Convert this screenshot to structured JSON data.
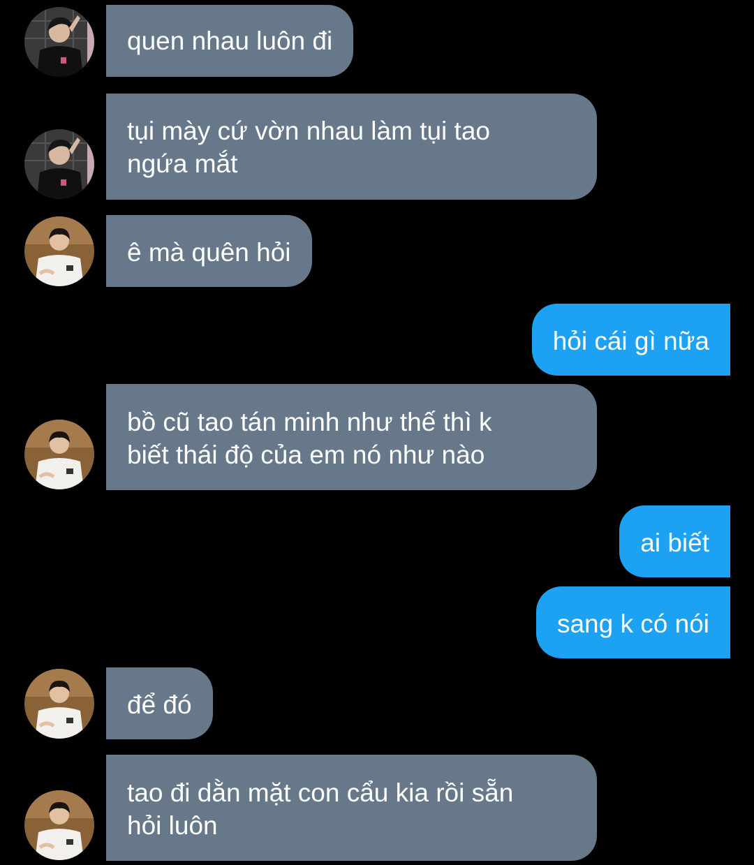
{
  "colors": {
    "background": "#000000",
    "incoming_bubble": "#66788a",
    "outgoing_bubble": "#1da1f2",
    "text": "#ffffff"
  },
  "messages": [
    {
      "direction": "incoming",
      "avatar": "avatar-black-shirt",
      "lines": [
        "quen nhau luôn đi"
      ]
    },
    {
      "direction": "incoming",
      "avatar": "avatar-black-shirt",
      "lines": [
        "tụi mày cứ vờn nhau làm tụi tao",
        "ngứa mắt"
      ]
    },
    {
      "direction": "incoming",
      "avatar": "avatar-white-shirt",
      "lines": [
        "ê mà quên hỏi"
      ]
    },
    {
      "direction": "outgoing",
      "lines": [
        "hỏi cái gì nữa"
      ]
    },
    {
      "direction": "incoming",
      "avatar": "avatar-white-shirt",
      "lines": [
        "bồ cũ tao tán minh như thế thì k",
        "biết thái độ của em nó như nào"
      ]
    },
    {
      "direction": "outgoing",
      "lines": [
        "ai biết"
      ]
    },
    {
      "direction": "outgoing",
      "lines": [
        "sang k có nói"
      ]
    },
    {
      "direction": "incoming",
      "avatar": "avatar-white-shirt",
      "lines": [
        "để đó"
      ]
    },
    {
      "direction": "incoming",
      "avatar": "avatar-white-shirt",
      "lines": [
        "tao đi dằn mặt con cẩu kia rồi sẵn",
        "hỏi luôn"
      ]
    }
  ]
}
